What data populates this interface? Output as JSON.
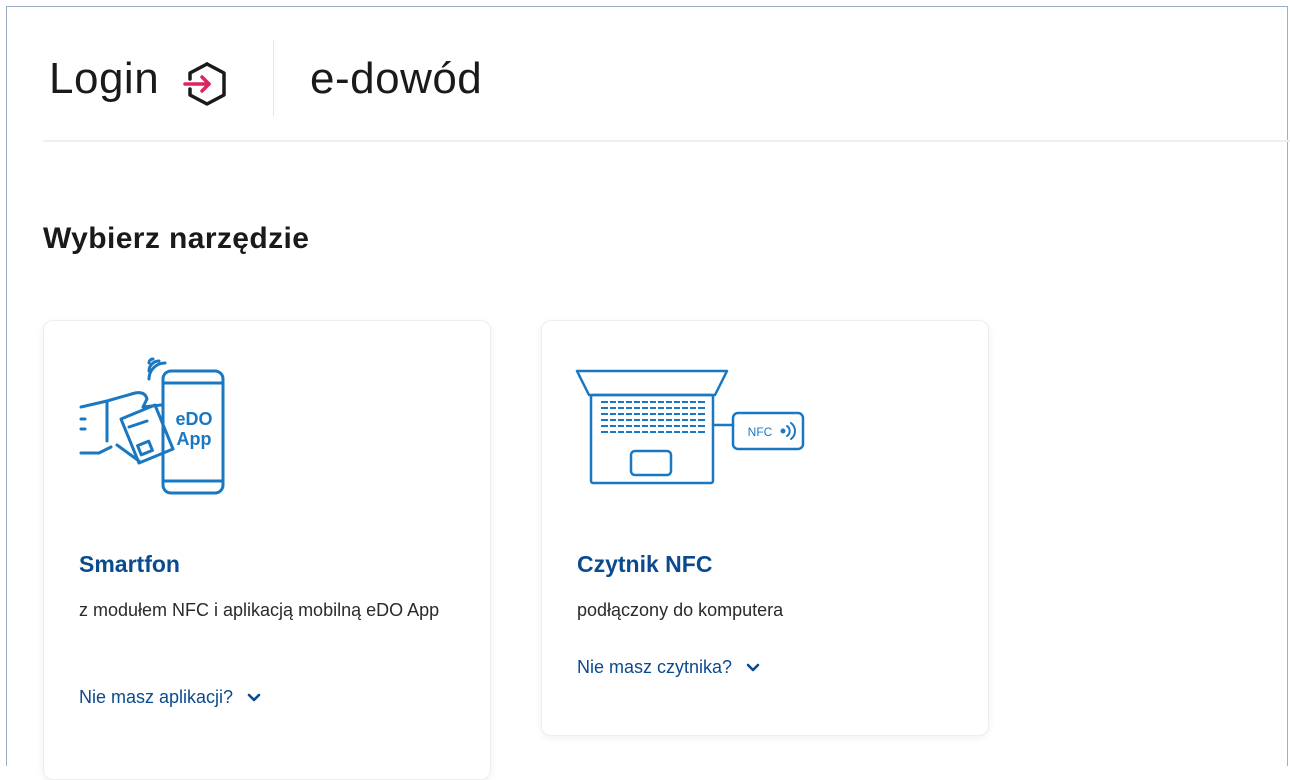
{
  "header": {
    "login_label": "Login",
    "service_label": "e-dowód"
  },
  "main": {
    "section_title": "Wybierz narzędzie",
    "cards": [
      {
        "title": "Smartfon",
        "description": "z modułem NFC i aplikacją mobilną eDO App",
        "link_label": "Nie masz aplikacji?",
        "illustration_icon": "hand-phone-card-icon",
        "illustration_text_line1": "eDO",
        "illustration_text_line2": "App"
      },
      {
        "title": "Czytnik NFC",
        "description": "podłączony do komputera",
        "link_label": "Nie masz czytnika?",
        "illustration_icon": "laptop-nfc-reader-icon",
        "illustration_text": "NFC"
      }
    ]
  },
  "colors": {
    "accent_blue": "#0a4a8f",
    "illustration_blue": "#1a78c2",
    "login_icon_accent": "#e0245e"
  }
}
